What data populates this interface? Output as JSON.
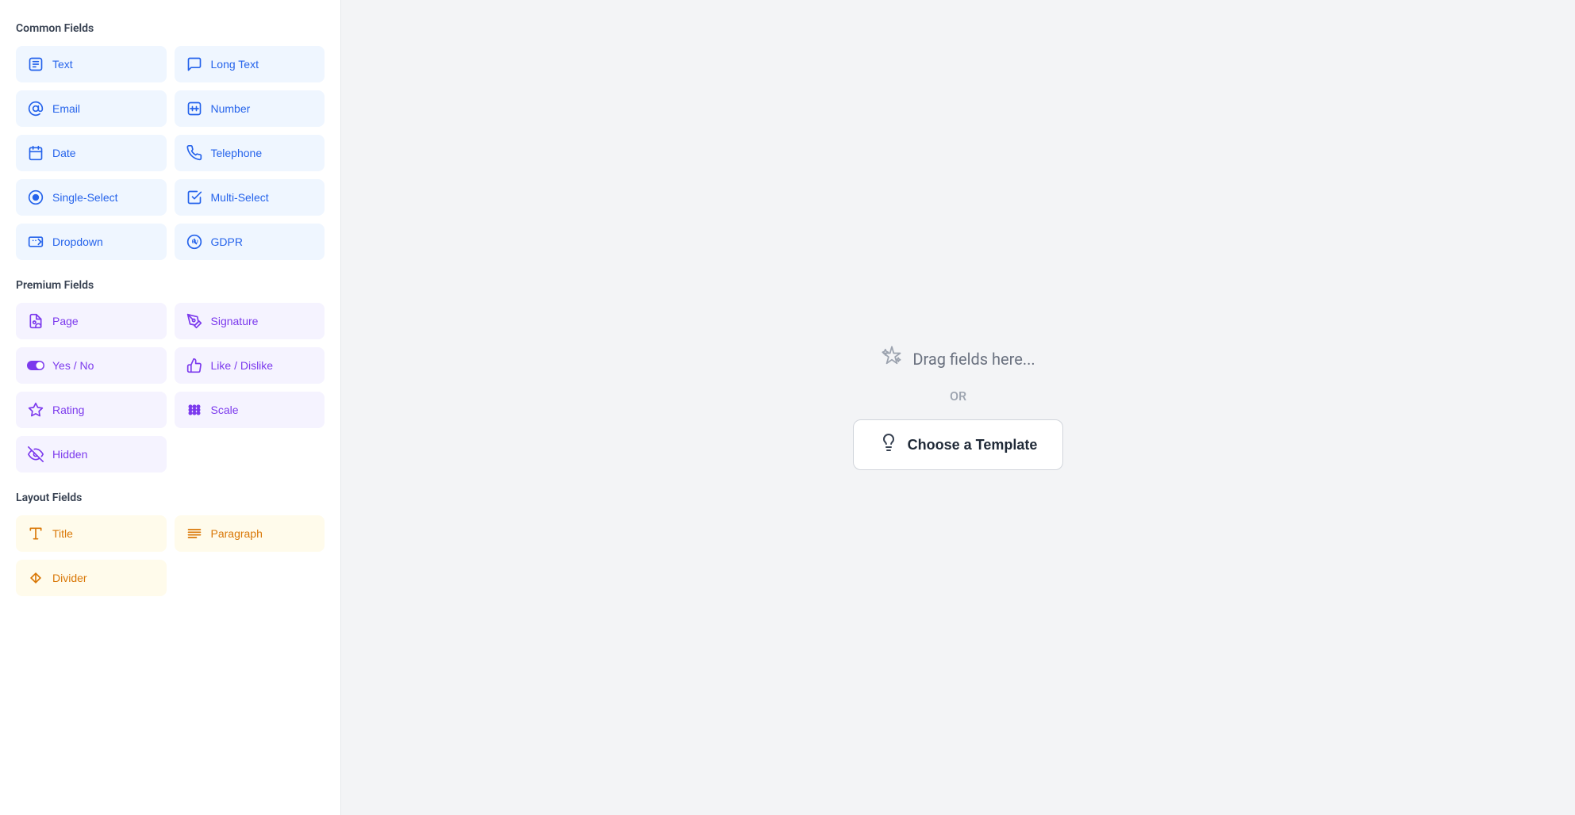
{
  "sidebar": {
    "sections": [
      {
        "id": "common",
        "title": "Common Fields",
        "type": "common",
        "fields": [
          {
            "id": "text",
            "label": "Text",
            "icon": "text"
          },
          {
            "id": "long-text",
            "label": "Long Text",
            "icon": "long-text"
          },
          {
            "id": "email",
            "label": "Email",
            "icon": "email"
          },
          {
            "id": "number",
            "label": "Number",
            "icon": "number"
          },
          {
            "id": "date",
            "label": "Date",
            "icon": "date"
          },
          {
            "id": "telephone",
            "label": "Telephone",
            "icon": "telephone"
          },
          {
            "id": "single-select",
            "label": "Single-Select",
            "icon": "single-select"
          },
          {
            "id": "multi-select",
            "label": "Multi-Select",
            "icon": "multi-select"
          },
          {
            "id": "dropdown",
            "label": "Dropdown",
            "icon": "dropdown"
          },
          {
            "id": "gdpr",
            "label": "GDPR",
            "icon": "gdpr"
          }
        ]
      },
      {
        "id": "premium",
        "title": "Premium Fields",
        "type": "premium",
        "fields": [
          {
            "id": "page",
            "label": "Page",
            "icon": "page"
          },
          {
            "id": "signature",
            "label": "Signature",
            "icon": "signature"
          },
          {
            "id": "yes-no",
            "label": "Yes / No",
            "icon": "yes-no"
          },
          {
            "id": "like-dislike",
            "label": "Like / Dislike",
            "icon": "like-dislike"
          },
          {
            "id": "rating",
            "label": "Rating",
            "icon": "rating"
          },
          {
            "id": "scale",
            "label": "Scale",
            "icon": "scale"
          },
          {
            "id": "hidden",
            "label": "Hidden",
            "icon": "hidden"
          }
        ]
      },
      {
        "id": "layout",
        "title": "Layout Fields",
        "type": "layout",
        "fields": [
          {
            "id": "title",
            "label": "Title",
            "icon": "title"
          },
          {
            "id": "paragraph",
            "label": "Paragraph",
            "icon": "paragraph"
          },
          {
            "id": "divider",
            "label": "Divider",
            "icon": "divider"
          }
        ]
      }
    ]
  },
  "main": {
    "drag_text": "Drag fields here...",
    "or_text": "OR",
    "choose_template_label": "Choose a Template"
  }
}
